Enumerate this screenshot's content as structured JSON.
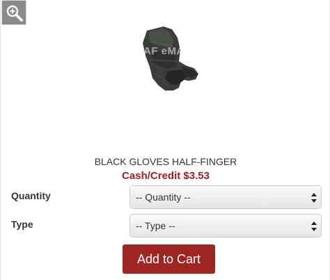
{
  "zoom_button": {
    "icon": "zoom-in-icon"
  },
  "product": {
    "image_watermark": "AF eMART",
    "name": "BLACK GLOVES HALF-FINGER",
    "price": "Cash/Credit $3.53"
  },
  "options": {
    "quantity": {
      "label": "Quantity",
      "selected": "-- Quantity --"
    },
    "type": {
      "label": "Type",
      "selected": "-- Type --"
    }
  },
  "cart": {
    "add_label": "Add to Cart"
  },
  "colors": {
    "price": "#a1201f",
    "button": "#9e2522",
    "zoom_bg": "#8a8a8a"
  }
}
